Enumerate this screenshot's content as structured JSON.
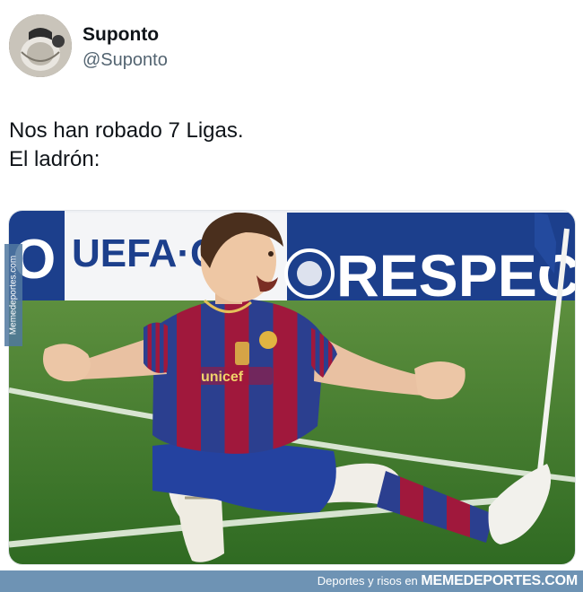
{
  "post": {
    "author": {
      "display_name": "Suponto",
      "handle": "@Suponto",
      "avatar_icon": "profile-avatar-icon"
    },
    "text_lines": [
      "Nos han robado 7 Ligas.",
      "El ladrón:"
    ],
    "image": {
      "board_text_left": "O  UEFA·C",
      "board_text_right": "RESPECT",
      "sponsor_text": "unicef"
    }
  },
  "watermark": {
    "side_text": "Memedeportes.com",
    "footer_prefix": "Deportes y risos en",
    "footer_brand": "MEMEDEPORTES.COM"
  },
  "colors": {
    "text_primary": "#0f1419",
    "text_secondary": "#536471",
    "footer_bg": "#6e93b4",
    "board_blue": "#1c3f8c",
    "pitch_green": "#3e7a2a"
  }
}
